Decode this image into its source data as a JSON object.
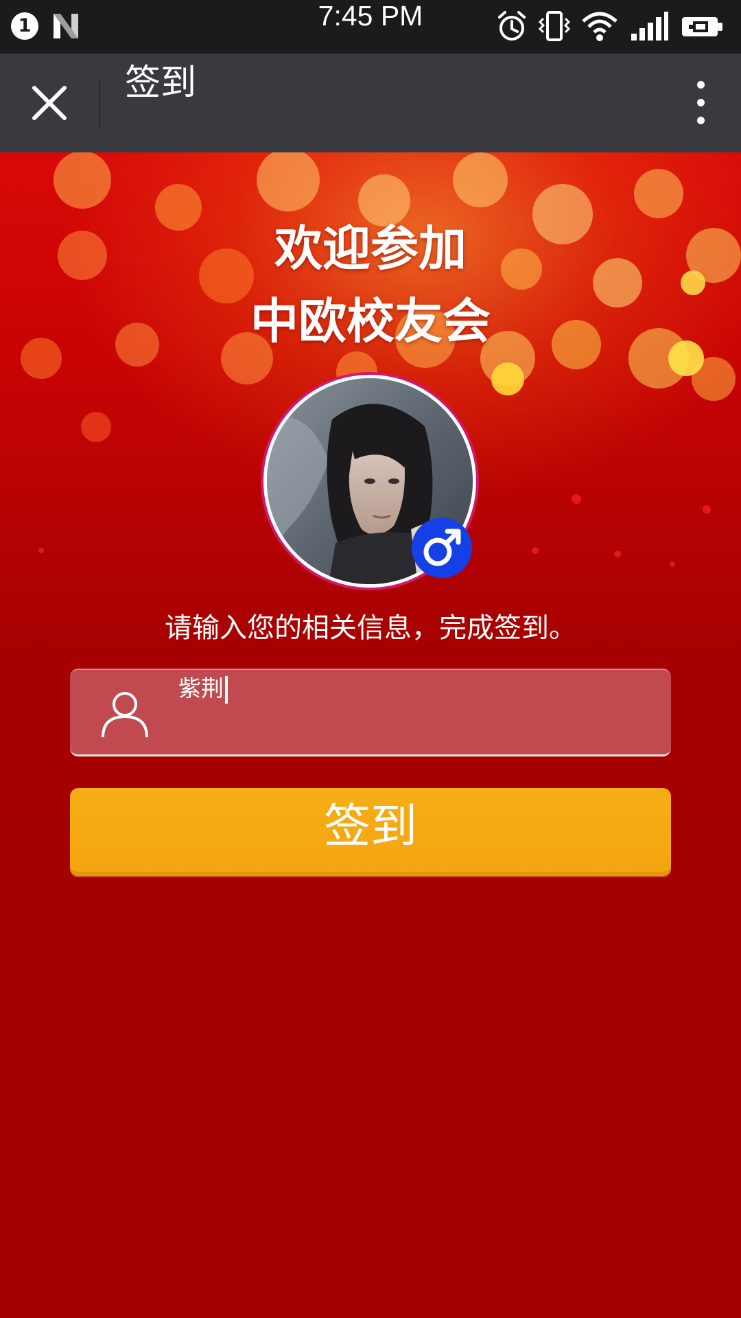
{
  "status_bar": {
    "notification_count": "1",
    "time": "7:45 PM",
    "icons": [
      "notification-badge",
      "n-logo-icon",
      "alarm-icon",
      "vibrate-icon",
      "wifi-icon",
      "signal-icon",
      "battery-icon"
    ]
  },
  "title_bar": {
    "title": "签到",
    "close_icon": "close-icon",
    "more_icon": "more-vertical-icon"
  },
  "hero": {
    "welcome_line1": "欢迎参加",
    "welcome_line2": "中欧校友会",
    "gender_symbol": "♂",
    "instruction": "请输入您的相关信息，完成签到。"
  },
  "form": {
    "name_value": "紫荆",
    "user_icon": "user-icon",
    "submit_label": "签到"
  },
  "colors": {
    "status_bar": "#1b1b1d",
    "title_bar": "#393a3f",
    "background": "#a30000",
    "input_bg": "#c04a4f",
    "button": "#f4a713",
    "gender_badge": "#1540e6",
    "avatar_ring": "#d0196a"
  }
}
